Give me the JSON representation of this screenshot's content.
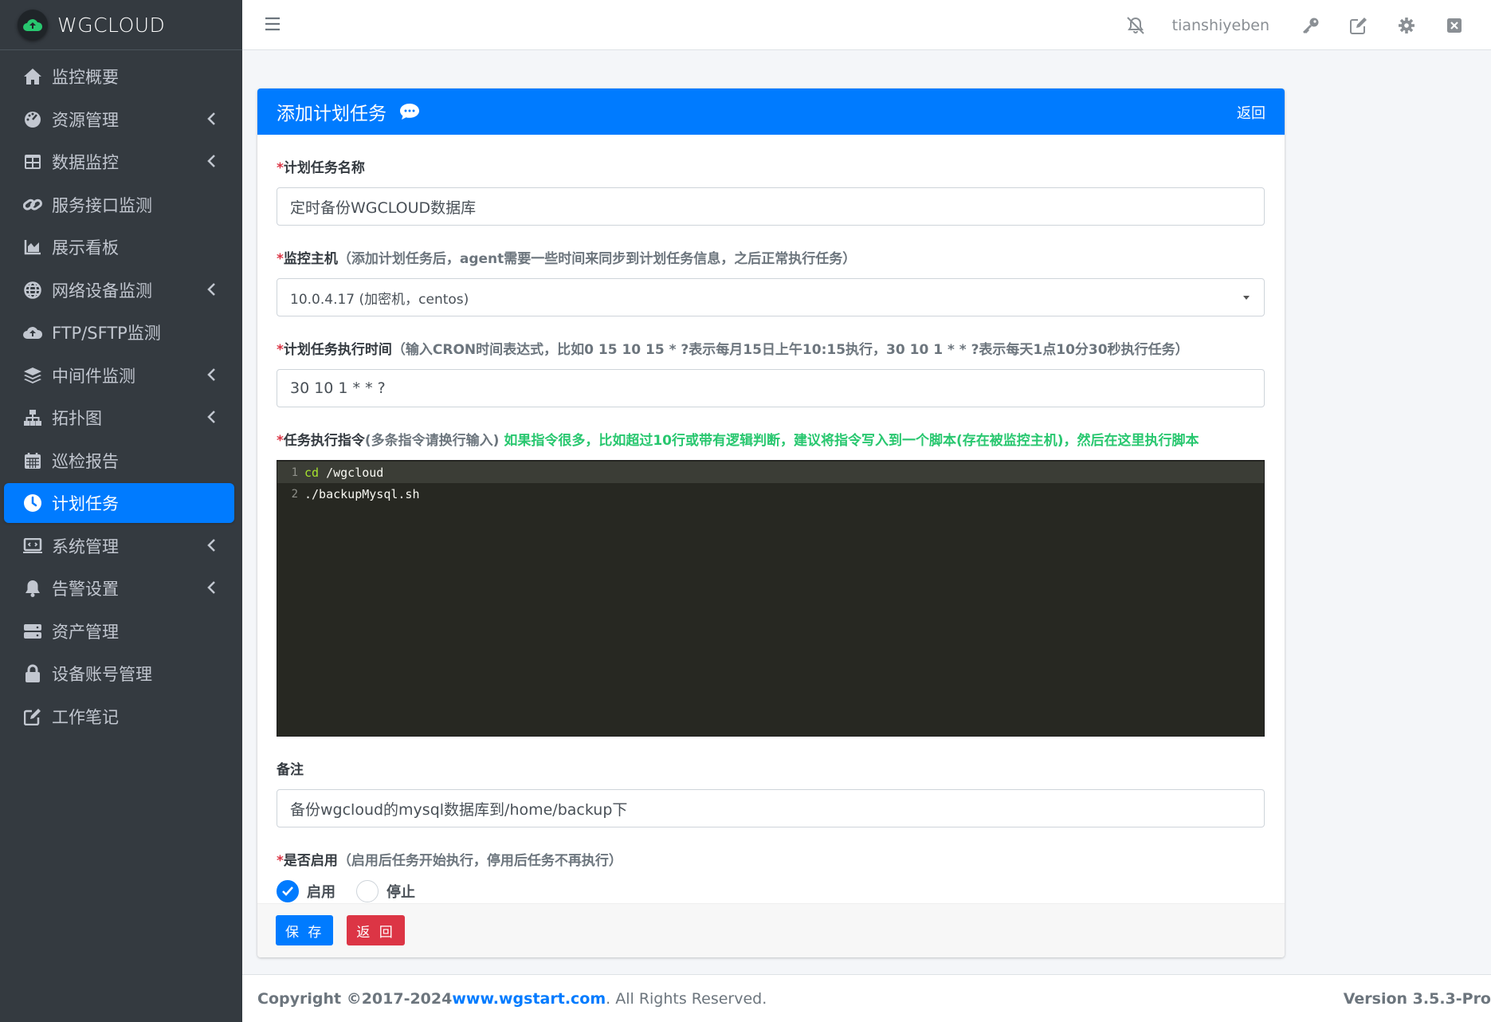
{
  "brand": {
    "name": "WGCLOUD"
  },
  "sidebar": {
    "items": [
      {
        "label": "监控概要",
        "icon": "home-icon",
        "has_children": false,
        "active": false
      },
      {
        "label": "资源管理",
        "icon": "tachometer-icon",
        "has_children": true,
        "active": false
      },
      {
        "label": "数据监控",
        "icon": "table-icon",
        "has_children": true,
        "active": false
      },
      {
        "label": "服务接口监测",
        "icon": "link-icon",
        "has_children": false,
        "active": false
      },
      {
        "label": "展示看板",
        "icon": "area-chart-icon",
        "has_children": false,
        "active": false
      },
      {
        "label": "网络设备监测",
        "icon": "globe-icon",
        "has_children": true,
        "active": false
      },
      {
        "label": "FTP/SFTP监测",
        "icon": "cloud-upload-icon",
        "has_children": false,
        "active": false
      },
      {
        "label": "中间件监测",
        "icon": "layers-icon",
        "has_children": true,
        "active": false
      },
      {
        "label": "拓扑图",
        "icon": "sitemap-icon",
        "has_children": true,
        "active": false
      },
      {
        "label": "巡检报告",
        "icon": "calendar-icon",
        "has_children": false,
        "active": false
      },
      {
        "label": "计划任务",
        "icon": "clock-icon",
        "has_children": false,
        "active": true
      },
      {
        "label": "系统管理",
        "icon": "laptop-code-icon",
        "has_children": true,
        "active": false
      },
      {
        "label": "告警设置",
        "icon": "bell-icon",
        "has_children": true,
        "active": false
      },
      {
        "label": "资产管理",
        "icon": "server-icon",
        "has_children": false,
        "active": false
      },
      {
        "label": "设备账号管理",
        "icon": "lock-icon",
        "has_children": false,
        "active": false
      },
      {
        "label": "工作笔记",
        "icon": "edit-icon",
        "has_children": false,
        "active": false
      }
    ]
  },
  "topbar": {
    "username": "tianshiyeben",
    "icons": [
      "bell-slash-icon",
      "key-icon",
      "edit-icon",
      "gear-icon",
      "close-window-icon"
    ]
  },
  "card": {
    "title": "添加计划任务",
    "back_link": "返回",
    "fields": {
      "name": {
        "label": "计划任务名称",
        "value": "定时备份WGCLOUD数据库"
      },
      "host": {
        "label": "监控主机",
        "hint": "（添加计划任务后，agent需要一些时间来同步到计划任务信息，之后正常执行任务）",
        "value": "10.0.4.17 (加密机，centos)"
      },
      "cron": {
        "label": "计划任务执行时间",
        "hint": "（输入CRON时间表达式，比如0 15 10 15 * ?表示每月15日上午10:15执行，30 10 1 * * ?表示每天1点10分30秒执行任务）",
        "value": "30 10 1 * * ?"
      },
      "command": {
        "label": "任务执行指令",
        "hint": "(多条指令请换行输入)",
        "warning": "如果指令很多，比如超过10行或带有逻辑判断，建议将指令写入到一个脚本(存在被监控主机)，然后在这里执行脚本",
        "lines": [
          {
            "num": "1",
            "keyword": "cd",
            "rest": " /wgcloud"
          },
          {
            "num": "2",
            "keyword": "",
            "rest": "./backupMysql.sh"
          }
        ]
      },
      "remark": {
        "label": "备注",
        "value": "备份wgcloud的mysql数据库到/home/backup下"
      },
      "enabled": {
        "label": "是否启用",
        "hint": "（启用后任务开始执行，停用后任务不再执行）",
        "options": [
          {
            "label": "启用",
            "checked": true
          },
          {
            "label": "停止",
            "checked": false
          }
        ]
      }
    },
    "buttons": {
      "save": "保 存",
      "back": "返 回"
    }
  },
  "footer": {
    "copyright": "Copyright ©2017-2024 ",
    "link": "www.wgstart.com",
    "rights": ". All Rights Reserved.",
    "version": "Version 3.5.3-Pro"
  },
  "colors": {
    "primary": "#007bff",
    "danger": "#dc3545",
    "sidebar": "#343a40",
    "warning_text": "#28c76f"
  }
}
